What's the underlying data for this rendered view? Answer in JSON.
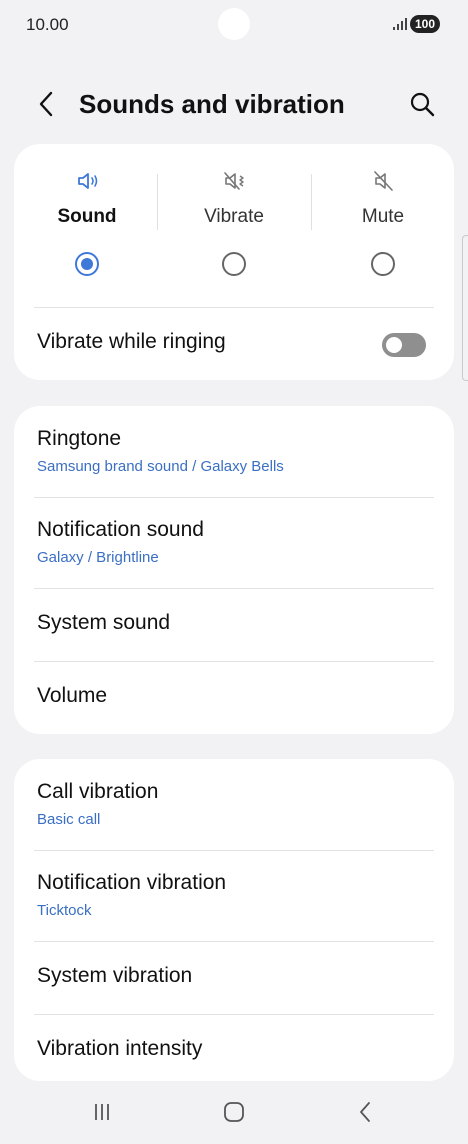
{
  "status_bar": {
    "time": "10.00",
    "battery": "100"
  },
  "header": {
    "title": "Sounds and vibration"
  },
  "sound_modes": [
    {
      "label": "Sound",
      "icon": "speaker-icon",
      "selected": true
    },
    {
      "label": "Vibrate",
      "icon": "vibrate-icon",
      "selected": false
    },
    {
      "label": "Mute",
      "icon": "mute-icon",
      "selected": false
    }
  ],
  "vibrate_while_ringing": {
    "label": "Vibrate while ringing",
    "enabled": false
  },
  "sound_settings": [
    {
      "title": "Ringtone",
      "subtitle": "Samsung brand sound / Galaxy Bells"
    },
    {
      "title": "Notification sound",
      "subtitle": "Galaxy / Brightline"
    },
    {
      "title": "System sound"
    },
    {
      "title": "Volume"
    }
  ],
  "vibration_settings": [
    {
      "title": "Call vibration",
      "subtitle": "Basic call"
    },
    {
      "title": "Notification vibration",
      "subtitle": "Ticktock"
    },
    {
      "title": "System vibration"
    },
    {
      "title": "Vibration intensity"
    }
  ],
  "colors": {
    "accent": "#3e78d8",
    "subtitle": "#3a6fc4",
    "background": "#f2f2f5"
  }
}
